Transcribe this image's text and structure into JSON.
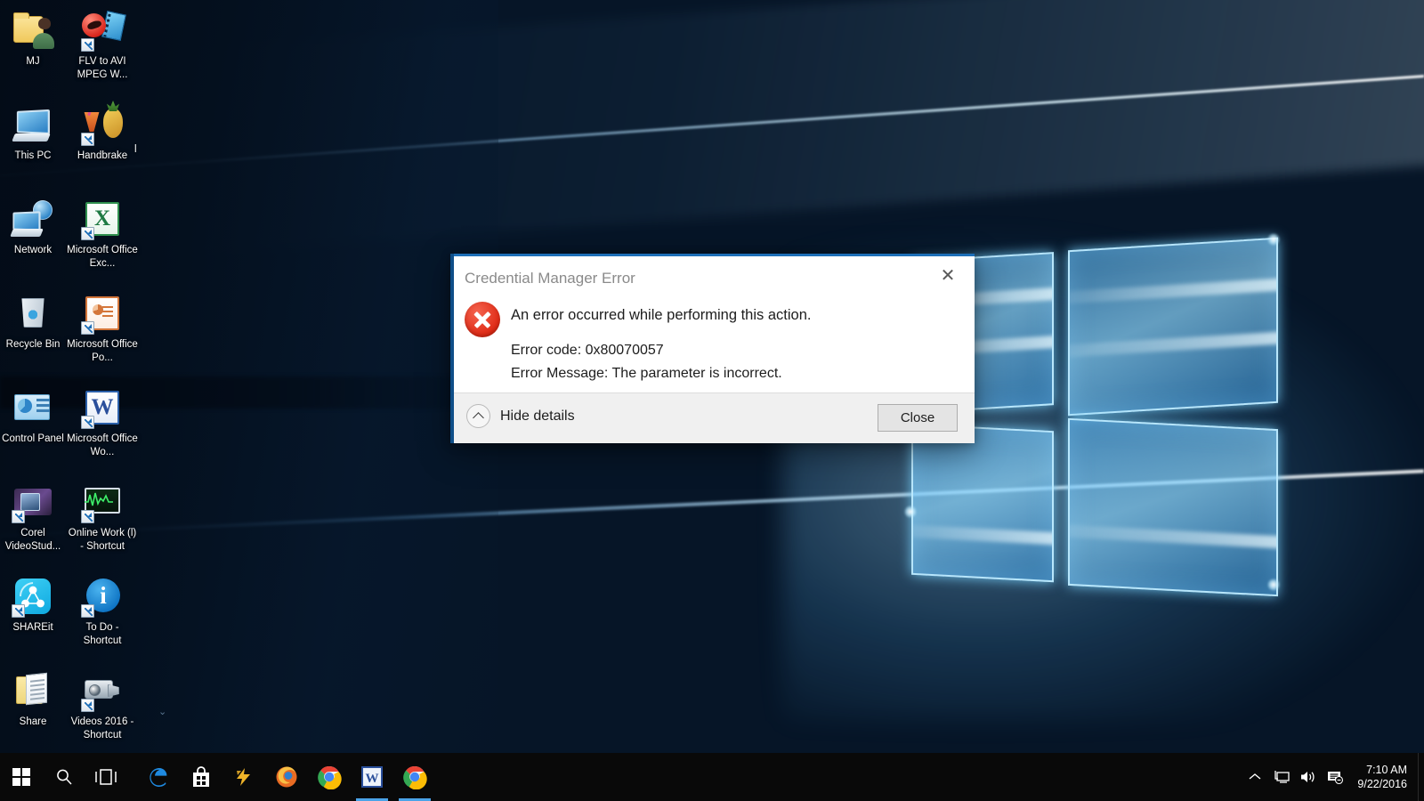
{
  "desktop": {
    "icons": [
      {
        "label": "MJ",
        "icon": "user-folder-icon",
        "shortcut": false
      },
      {
        "label": "FLV to AVI MPEG W...",
        "icon": "flv-to-avi-converter-icon",
        "shortcut": true
      },
      {
        "label": "This PC",
        "icon": "this-pc-icon",
        "shortcut": false
      },
      {
        "label": "Handbrake",
        "icon": "handbrake-icon",
        "shortcut": true
      },
      {
        "label": "Network",
        "icon": "network-icon",
        "shortcut": false
      },
      {
        "label": "Microsoft Office Exc...",
        "icon": "excel-icon",
        "shortcut": true
      },
      {
        "label": "Recycle Bin",
        "icon": "recycle-bin-icon",
        "shortcut": false
      },
      {
        "label": "Microsoft Office Po...",
        "icon": "powerpoint-icon",
        "shortcut": true
      },
      {
        "label": "Control Panel",
        "icon": "control-panel-icon",
        "shortcut": false
      },
      {
        "label": "Microsoft Office Wo...",
        "icon": "word-icon",
        "shortcut": true
      },
      {
        "label": "Corel VideoStud...",
        "icon": "corel-videostudio-icon",
        "shortcut": true
      },
      {
        "label": "Online Work (l) - Shortcut",
        "icon": "online-work-icon",
        "shortcut": true
      },
      {
        "label": "SHAREit",
        "icon": "shareit-icon",
        "shortcut": true
      },
      {
        "label": "To Do - Shortcut",
        "icon": "to-do-icon",
        "shortcut": true
      },
      {
        "label": "Share",
        "icon": "share-folder-icon",
        "shortcut": false
      },
      {
        "label": "Videos 2016 - Shortcut",
        "icon": "videos-2016-icon",
        "shortcut": true
      }
    ],
    "clipped_text": "l",
    "overflow_chevron": "⌄"
  },
  "dialog": {
    "title": "Credential Manager Error",
    "close_icon": "✕",
    "error_icon": "error-x-icon",
    "message": "An error occurred while performing this action.",
    "detail_code": "Error code: 0x80070057",
    "detail_message": "Error Message: The parameter is incorrect.",
    "hide_details_label": "Hide details",
    "close_button_label": "Close",
    "accent_color": "#1d6fb8",
    "error_color": "#e02b16"
  },
  "taskbar": {
    "start_label": "Start",
    "search_label": "Search",
    "task_view_label": "Task View",
    "apps": [
      {
        "name": "Microsoft Edge",
        "icon": "edge-icon",
        "active": false
      },
      {
        "name": "Microsoft Store",
        "icon": "store-icon",
        "active": false
      },
      {
        "name": "Winamp",
        "icon": "winamp-icon",
        "active": false
      },
      {
        "name": "Mozilla Firefox",
        "icon": "firefox-icon",
        "active": false
      },
      {
        "name": "Google Chrome",
        "icon": "chrome-icon",
        "active": false
      },
      {
        "name": "Microsoft Word",
        "icon": "word-icon",
        "active": true
      },
      {
        "name": "Google Chrome",
        "icon": "chrome-icon",
        "active": true
      }
    ],
    "tray": {
      "show_hidden_label": "Show hidden icons",
      "network_label": "Network",
      "volume_label": "Volume",
      "action_center_label": "Action Center",
      "time": "7:10 AM",
      "date": "9/22/2016"
    }
  }
}
